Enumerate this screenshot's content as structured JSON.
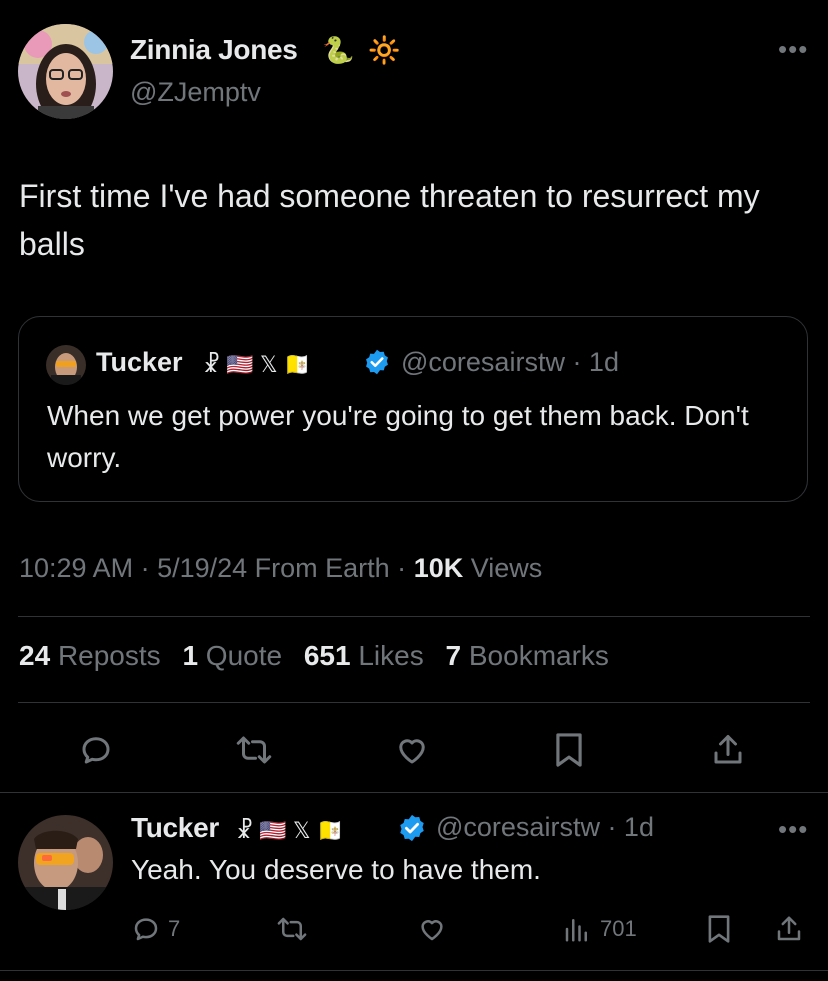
{
  "tweet": {
    "author_name": "Zinnia Jones",
    "name_emojis": [
      "🐍",
      "🔆"
    ],
    "handle": "@ZJemptv",
    "text": "First time I've had someone threaten to resurrect my balls",
    "timestamp": "10:29 AM · 5/19/24 From Earth · ",
    "views_count": "10K",
    "views_label": " Views",
    "stats": [
      {
        "num": "24",
        "label": "Reposts"
      },
      {
        "num": "1",
        "label": "Quote"
      },
      {
        "num": "651",
        "label": "Likes"
      },
      {
        "num": "7",
        "label": "Bookmarks"
      }
    ]
  },
  "quote": {
    "author_name": "Tucker",
    "name_glyphs": "☧ 🇺🇸 𝕏 🇻🇦",
    "handle_time": "@coresairstw · 1d",
    "text": "When we get power you're going to get them back. Don't worry."
  },
  "reply": {
    "author_name": "Tucker",
    "name_glyphs": "☧ 🇺🇸 𝕏 🇻🇦",
    "handle_time": "@coresairstw · 1d",
    "text": "Yeah. You deserve to have them.",
    "reply_count": "7",
    "views_count": "701"
  },
  "icons": [
    "reply-icon",
    "repost-icon",
    "like-icon",
    "bookmark-icon",
    "share-icon",
    "views-icon",
    "more-icon",
    "verified-icon"
  ],
  "colors": {
    "background": "#000000",
    "primary_text": "#e7e9ea",
    "secondary_text": "#71767b",
    "border": "#2f3336",
    "verified": "#1d9bf0"
  }
}
